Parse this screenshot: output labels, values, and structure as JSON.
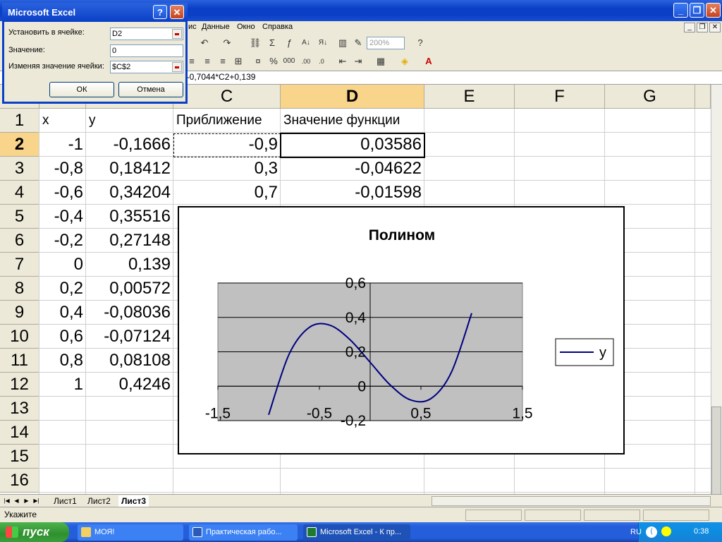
{
  "window": {
    "title": "Microsoft Excel"
  },
  "menu": [
    "ис",
    "Данные",
    "Окно",
    "Справка"
  ],
  "toolbar": {
    "zoom": "200%"
  },
  "formula_bar": {
    "content": "2-0,7044*C2+0,139"
  },
  "dialog": {
    "title": "Microsoft Excel",
    "set_cell_label": "Установить в ячейке:",
    "set_cell_value": "D2",
    "to_value_label": "Значение:",
    "to_value_value": "0",
    "changing_label": "Изменяя значение ячейки:",
    "changing_value": "$C$2",
    "ok_label": "ОК",
    "cancel_label": "Отмена"
  },
  "sheet": {
    "columns": [
      "C",
      "D",
      "E",
      "F",
      "G"
    ],
    "rows": [
      "1",
      "2",
      "3",
      "4",
      "5",
      "6",
      "7",
      "8",
      "9",
      "10",
      "11",
      "12",
      "13",
      "14",
      "15",
      "16"
    ],
    "headers": {
      "x": "x",
      "y": "y",
      "approx": "Приближение",
      "func": "Значение функции"
    },
    "x": [
      "-1",
      "-0,8",
      "-0,6",
      "-0,4",
      "-0,2",
      "0",
      "0,2",
      "0,4",
      "0,6",
      "0,8",
      "1"
    ],
    "y": [
      "-0,1666",
      "0,18412",
      "0,34204",
      "0,35516",
      "0,27148",
      "0,139",
      "0,00572",
      "-0,08036",
      "-0,07124",
      "0,08108",
      "0,4246"
    ],
    "approx": [
      "-0,9",
      "0,3",
      "0,7"
    ],
    "func": [
      "0,03586",
      "-0,04622",
      "-0,01598"
    ]
  },
  "tabs": [
    "Лист1",
    "Лист2",
    "Лист3"
  ],
  "status": {
    "text": "Укажите"
  },
  "taskbar": {
    "start": "пуск",
    "tasks": [
      "МОЯ!",
      "Практическая рабо...",
      "Microsoft Excel - К пр..."
    ],
    "lang": "RU",
    "time": "0:38"
  },
  "chart_data": {
    "type": "line",
    "title": "Полином",
    "xlabel": "",
    "ylabel": "",
    "x": [
      -1,
      -0.8,
      -0.6,
      -0.4,
      -0.2,
      0,
      0.2,
      0.4,
      0.6,
      0.8,
      1
    ],
    "series": [
      {
        "name": "y",
        "values": [
          -0.1666,
          0.18412,
          0.34204,
          0.35516,
          0.27148,
          0.139,
          0.00572,
          -0.08036,
          -0.07124,
          0.08108,
          0.4246
        ]
      }
    ],
    "xlim": [
      -1.5,
      1.5
    ],
    "ylim": [
      -0.2,
      0.6
    ],
    "x_ticks": [
      "-1,5",
      "-0,5",
      "0,5",
      "1,5"
    ],
    "y_ticks": [
      "-0,2",
      "0",
      "0,2",
      "0,4",
      "0,6"
    ],
    "legend": "right",
    "grid": true,
    "plot_bg": "#c0c0c0",
    "line_color": "#000080"
  }
}
